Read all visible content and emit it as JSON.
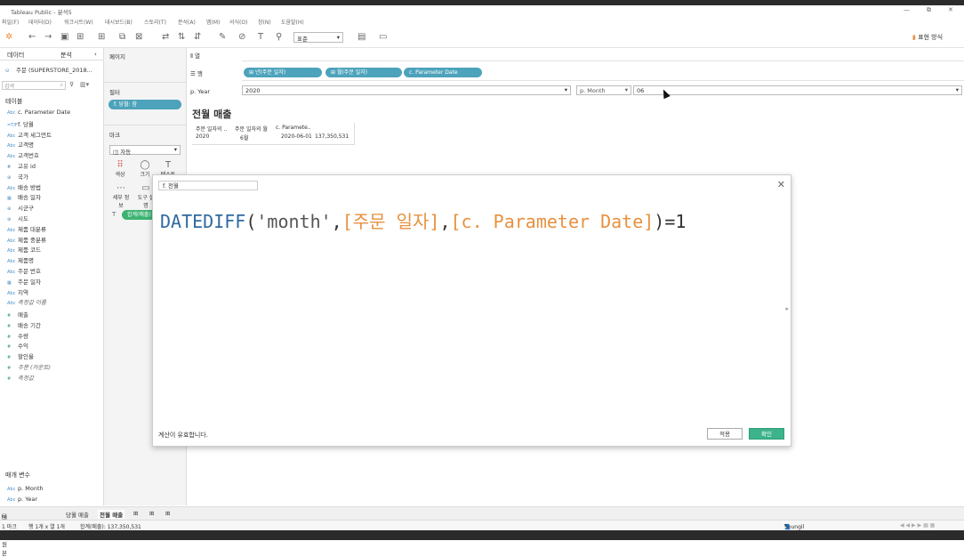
{
  "window": {
    "title": "Tableau Public - 분석5",
    "minimize": "—",
    "restore": "⧉",
    "close": "✕"
  },
  "menu": [
    "파일(F)",
    "데이터(D)",
    "워크시트(W)",
    "대시보드(B)",
    "스토리(T)",
    "분석(A)",
    "맵(M)",
    "서식(O)",
    "창(N)",
    "도움말(H)"
  ],
  "toolbar": {
    "fit_select": "표준",
    "show_me": "표현 방식"
  },
  "left_panel": {
    "tab_data": "데이터",
    "tab_analysis": "분석",
    "datasource": "주문 (SUPERSTORE_2018...",
    "search_placeholder": "검색",
    "tables_header": "테이블",
    "dimensions": [
      {
        "icon": "Abc",
        "label": "c. Parameter Date"
      },
      {
        "icon": "=T/F",
        "label": "f. 당월"
      },
      {
        "icon": "Abc",
        "label": "고객 세그먼트"
      },
      {
        "icon": "Abc",
        "label": "고객명"
      },
      {
        "icon": "Abc",
        "label": "고객번호"
      },
      {
        "icon": "#",
        "label": "고유 id"
      },
      {
        "icon": "⊕",
        "label": "국가"
      },
      {
        "icon": "Abc",
        "label": "배송 방법"
      },
      {
        "icon": "▦",
        "label": "배송 일자"
      },
      {
        "icon": "⊕",
        "label": "시군구"
      },
      {
        "icon": "⊕",
        "label": "시도"
      },
      {
        "icon": "Abc",
        "label": "제품 대분류"
      },
      {
        "icon": "Abc",
        "label": "제품 중분류"
      },
      {
        "icon": "Abc",
        "label": "제품 코드"
      },
      {
        "icon": "Abc",
        "label": "제품명"
      },
      {
        "icon": "Abc",
        "label": "주문 번호"
      },
      {
        "icon": "▦",
        "label": "주문 일자"
      },
      {
        "icon": "Abc",
        "label": "지역"
      },
      {
        "icon": "Abc",
        "label": "측정값 이름"
      }
    ],
    "measures": [
      {
        "icon": "#",
        "label": "매출"
      },
      {
        "icon": "#",
        "label": "배송 기간"
      },
      {
        "icon": "#",
        "label": "수량"
      },
      {
        "icon": "#",
        "label": "수익"
      },
      {
        "icon": "#",
        "label": "할인율"
      },
      {
        "icon": "#",
        "label": "주문 (카운트)"
      },
      {
        "icon": "#",
        "label": "측정값"
      }
    ],
    "params_header": "매개 변수",
    "params": [
      {
        "icon": "Abc",
        "label": "p. Month"
      },
      {
        "icon": "Abc",
        "label": "p. Year"
      }
    ]
  },
  "mid_panel": {
    "pages": "페이지",
    "filters": "필터",
    "filter_pill": "f. 당월: 참",
    "marks": "마크",
    "marks_type": "자동",
    "mark_cards": [
      {
        "icon": "⠿",
        "label": "색상"
      },
      {
        "icon": "◯",
        "label": "크기"
      },
      {
        "icon": "T",
        "label": "텍스트"
      },
      {
        "icon": "⋯",
        "label": "세부 정보"
      },
      {
        "icon": "▭",
        "label": "도구 설명"
      }
    ],
    "marks_pill": "합계(매출)"
  },
  "shelves": {
    "columns_label": "열",
    "rows_label": "행",
    "row_pills": [
      "년(주문 일자)",
      "월(주문 일자)",
      "c. Parameter Date"
    ]
  },
  "params_bar": {
    "year_label": "p. Year",
    "year_value": "2020",
    "month_label": "p. Month",
    "month_value": "06"
  },
  "sheet": {
    "title": "전월 매출",
    "headers": [
      "주문 일자의 ..",
      "주문 일자의 월",
      "c. Paramete.."
    ],
    "row": [
      "2020",
      "6월",
      "2020-06-01",
      "137,350,531"
    ]
  },
  "calc_dialog": {
    "name": "f. 전월",
    "formula": {
      "fn": "DATEDIFF",
      "open": "(",
      "str": "'month'",
      "c1": ",",
      "f1": "[주문 일자]",
      "c2": ",",
      "f2": "[c. Parameter Date]",
      "close": ")",
      "op": "=1"
    },
    "status": "계산이 유효합니다.",
    "apply": "적용",
    "ok": "확인"
  },
  "bottom_tabs": [
    "데이터 원본",
    "당월 매출",
    "전월 매출"
  ],
  "status_bar": {
    "marks": "1 마크",
    "dims": "행 1개 x 열 1개",
    "sum": "합계(매출): 137,350,531",
    "user": "Seungil Kang"
  }
}
